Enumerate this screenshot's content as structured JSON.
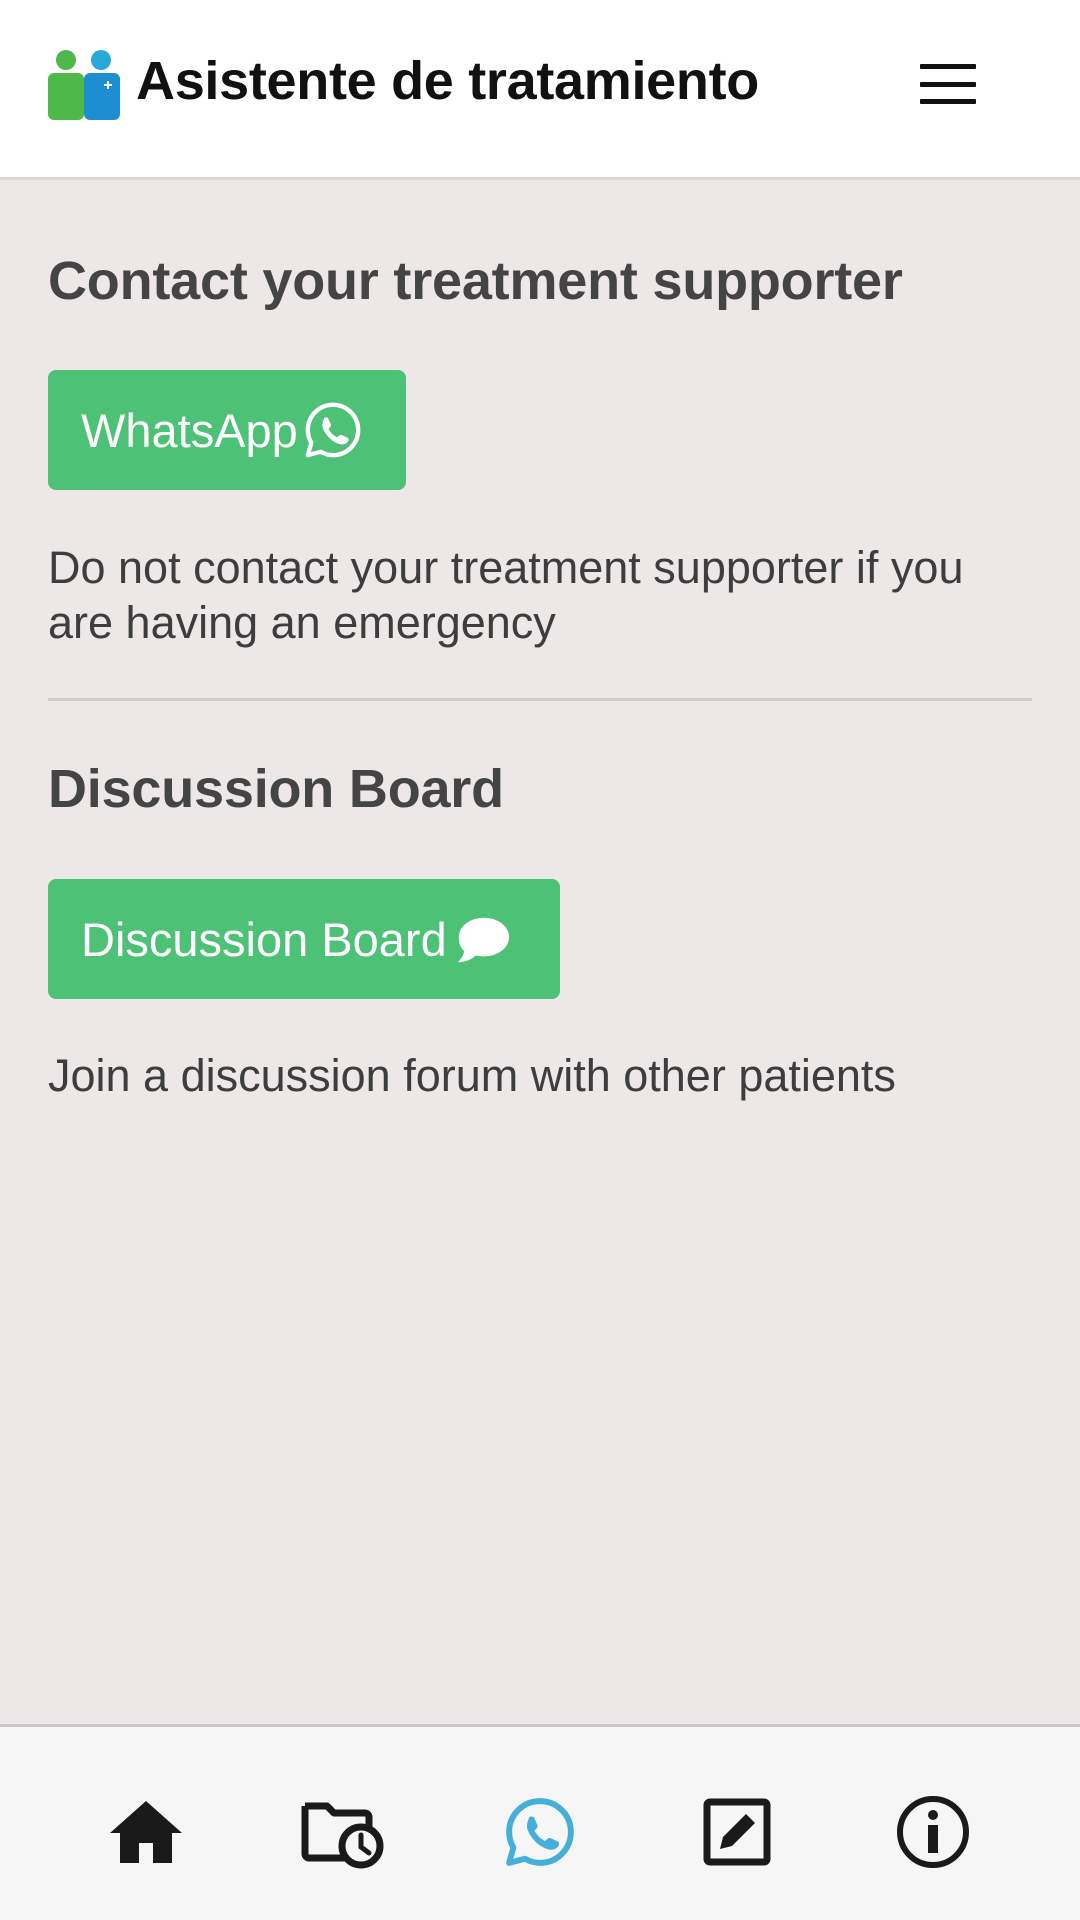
{
  "header": {
    "title": "Asistente de tratamiento",
    "logo_icon": "people-icon",
    "menu_icon": "hamburger-menu-icon"
  },
  "contact_section": {
    "title": "Contact your treatment supporter",
    "button_label": "WhatsApp",
    "button_icon": "whatsapp-icon",
    "description": "Do not contact your treatment supporter if you are having an emergency"
  },
  "discussion_section": {
    "title": "Discussion Board",
    "button_label": "Discussion Board",
    "button_icon": "speech-bubble-icon",
    "description": "Join a discussion forum with other patients"
  },
  "bottom_nav": {
    "items": [
      {
        "icon": "home-icon",
        "active": false
      },
      {
        "icon": "folder-clock-icon",
        "active": false
      },
      {
        "icon": "whatsapp-icon",
        "active": true
      },
      {
        "icon": "edit-icon",
        "active": false
      },
      {
        "icon": "info-icon",
        "active": false
      }
    ],
    "active_color": "#45aed9",
    "inactive_color": "#1a1a1a"
  },
  "colors": {
    "button_green": "#4dc277",
    "background": "#ede7e7",
    "header_bg": "#ffffff"
  }
}
